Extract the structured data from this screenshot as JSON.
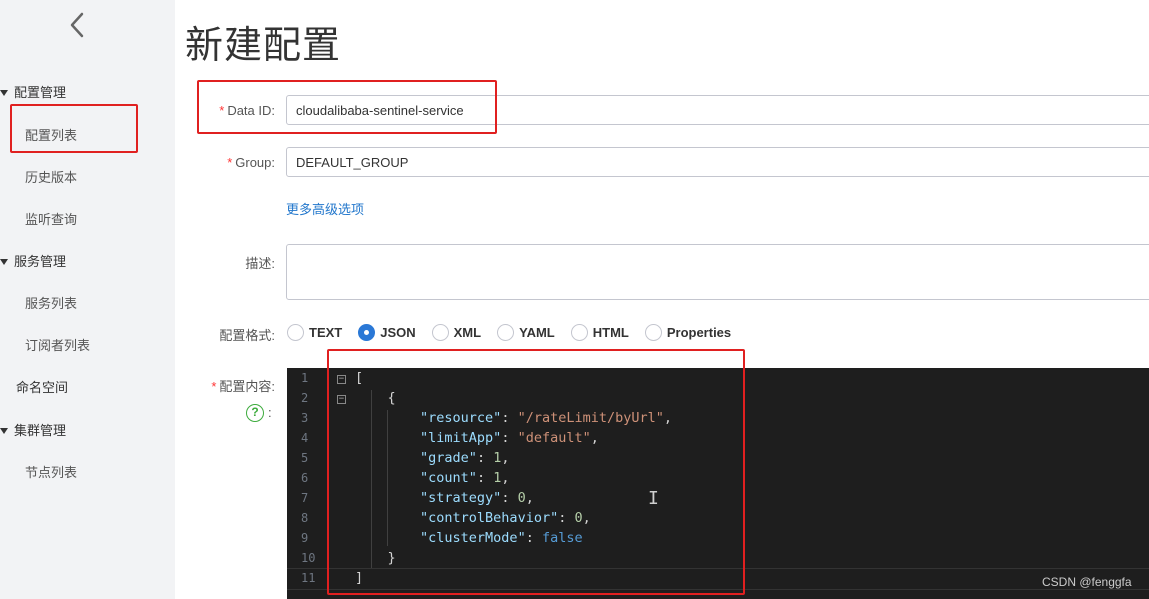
{
  "sidebar": {
    "back_icon": "chevron-left-icon",
    "groups": [
      {
        "label": "配置管理",
        "items": [
          "配置列表",
          "历史版本",
          "监听查询"
        ]
      },
      {
        "label": "服务管理",
        "items": [
          "服务列表",
          "订阅者列表"
        ]
      },
      {
        "label": "命名空间"
      },
      {
        "label": "集群管理",
        "items": [
          "节点列表"
        ]
      }
    ]
  },
  "page": {
    "title": "新建配置"
  },
  "form": {
    "required_mark": "*",
    "data_id_label": "Data ID:",
    "data_id_value": "cloudalibaba-sentinel-service",
    "group_label": "Group:",
    "group_value": "DEFAULT_GROUP",
    "advanced_link": "更多高级选项",
    "desc_label": "描述:",
    "format_label": "配置格式:",
    "formats": [
      "TEXT",
      "JSON",
      "XML",
      "YAML",
      "HTML",
      "Properties"
    ],
    "selected_format": "JSON",
    "content_label": "配置内容:",
    "help_icon": "?",
    "help_colon": ":"
  },
  "editor": {
    "line_numbers": [
      "1",
      "2",
      "3",
      "4",
      "5",
      "6",
      "7",
      "8",
      "9",
      "10",
      "11"
    ],
    "lines": {
      "l1": "[",
      "l2": "{",
      "l3_key": "\"resource\"",
      "l3_val": "\"/rateLimit/byUrl\"",
      "l4_key": "\"limitApp\"",
      "l4_val": "\"default\"",
      "l5_key": "\"grade\"",
      "l5_val": "1",
      "l6_key": "\"count\"",
      "l6_val": "1",
      "l7_key": "\"strategy\"",
      "l7_val": "0",
      "l8_key": "\"controlBehavior\"",
      "l8_val": "0",
      "l9_key": "\"clusterMode\"",
      "l9_val": "false",
      "l10": "}",
      "l11": "]"
    }
  },
  "watermark": "CSDN @fenggfa",
  "colors": {
    "accent": "#2a78d6",
    "required": "#ff3333",
    "highlight_box": "#e02020",
    "help": "#3dab3d"
  }
}
